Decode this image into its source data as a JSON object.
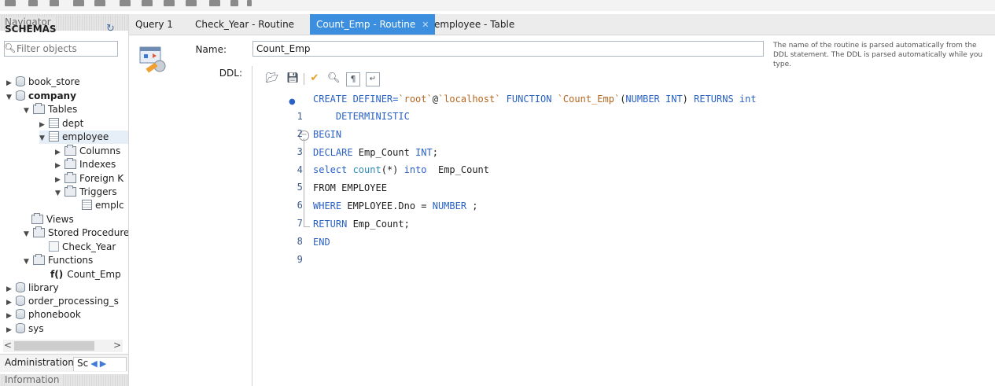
{
  "navigator": {
    "header": "Navigator",
    "schemas_title": "SCHEMAS",
    "filter_placeholder": "Filter objects",
    "tree": [
      {
        "label": "book_store"
      },
      {
        "label": "company"
      },
      {
        "label": "Tables"
      },
      {
        "label": "dept"
      },
      {
        "label": "employee"
      },
      {
        "label": "Columns"
      },
      {
        "label": "Indexes"
      },
      {
        "label": "Foreign K"
      },
      {
        "label": "Triggers"
      },
      {
        "label": "emplc"
      },
      {
        "label": "Views"
      },
      {
        "label": "Stored Procedure"
      },
      {
        "label": "Check_Year"
      },
      {
        "label": "Functions"
      },
      {
        "label": "Count_Emp",
        "prefix": "f()"
      },
      {
        "label": "library"
      },
      {
        "label": "order_processing_s"
      },
      {
        "label": "phonebook"
      },
      {
        "label": "sys"
      }
    ],
    "bottom_tabs": {
      "administration": "Administration",
      "schemas": "Sc"
    },
    "info_header": "Information"
  },
  "tabs": [
    {
      "label": "Query 1"
    },
    {
      "label": "Check_Year - Routine"
    },
    {
      "label": "Count_Emp - Routine",
      "active": true
    },
    {
      "label": "employee - Table"
    }
  ],
  "routine": {
    "name_label": "Name:",
    "name_value": "Count_Emp",
    "ddl_label": "DDL:",
    "help_text": "The name of the routine is parsed automatically from the DDL statement. The DDL is parsed automatically while you type."
  },
  "code_lines": [
    {
      "n": "1",
      "t1": "CREATE DEFINER=",
      "t2": "`root`",
      "t3": "@",
      "t4": "`localhost`",
      "t5": " FUNCTION ",
      "t6": "`Count_Emp`",
      "t7": "(",
      "t8": "NUMBER INT",
      "t9": ") ",
      "t10": "RETURNS int"
    },
    {
      "n": "2",
      "t1": "    DETERMINISTIC"
    },
    {
      "n": "3",
      "t1": "BEGIN"
    },
    {
      "n": "4",
      "t1": "DECLARE",
      "t2": " Emp_Count ",
      "t3": "INT",
      "t4": ";"
    },
    {
      "n": "5",
      "t1": "select",
      "t2": " count",
      "t3": "(*) ",
      "t4": "into",
      "t5": "  Emp_Count"
    },
    {
      "n": "6",
      "t1": "FROM EMPLOYEE"
    },
    {
      "n": "7",
      "t1": "WHERE",
      "t2": " EMPLOYEE.Dno = ",
      "t3": "NUMBER",
      "t4": " ;"
    },
    {
      "n": "8",
      "t1": "RETURN",
      "t2": " Emp_Count;"
    },
    {
      "n": "9",
      "t1": "END"
    }
  ]
}
